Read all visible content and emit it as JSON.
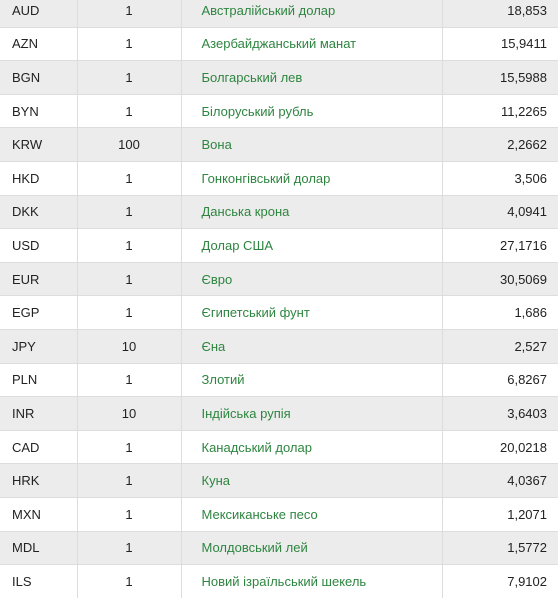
{
  "rows": [
    {
      "code": "AUD",
      "units": "1",
      "name": "Австралійський долар",
      "rate": "18,853"
    },
    {
      "code": "AZN",
      "units": "1",
      "name": "Азербайджанський манат",
      "rate": "15,9411"
    },
    {
      "code": "BGN",
      "units": "1",
      "name": "Болгарський лев",
      "rate": "15,5988"
    },
    {
      "code": "BYN",
      "units": "1",
      "name": "Білоруський рубль",
      "rate": "11,2265"
    },
    {
      "code": "KRW",
      "units": "100",
      "name": "Вона",
      "rate": "2,2662"
    },
    {
      "code": "HKD",
      "units": "1",
      "name": "Гонконгівський долар",
      "rate": "3,506"
    },
    {
      "code": "DKK",
      "units": "1",
      "name": "Данська крона",
      "rate": "4,0941"
    },
    {
      "code": "USD",
      "units": "1",
      "name": "Долар США",
      "rate": "27,1716"
    },
    {
      "code": "EUR",
      "units": "1",
      "name": "Євро",
      "rate": "30,5069"
    },
    {
      "code": "EGP",
      "units": "1",
      "name": "Єгипетський фунт",
      "rate": "1,686"
    },
    {
      "code": "JPY",
      "units": "10",
      "name": "Єна",
      "rate": "2,527"
    },
    {
      "code": "PLN",
      "units": "1",
      "name": "Злотий",
      "rate": "6,8267"
    },
    {
      "code": "INR",
      "units": "10",
      "name": "Індійська рупія",
      "rate": "3,6403"
    },
    {
      "code": "CAD",
      "units": "1",
      "name": "Канадський долар",
      "rate": "20,0218"
    },
    {
      "code": "HRK",
      "units": "1",
      "name": "Куна",
      "rate": "4,0367"
    },
    {
      "code": "MXN",
      "units": "1",
      "name": "Мексиканське песо",
      "rate": "1,2071"
    },
    {
      "code": "MDL",
      "units": "1",
      "name": "Молдовський лей",
      "rate": "1,5772"
    },
    {
      "code": "ILS",
      "units": "1",
      "name": "Новий ізраїльський шекель",
      "rate": "7,9102"
    }
  ]
}
